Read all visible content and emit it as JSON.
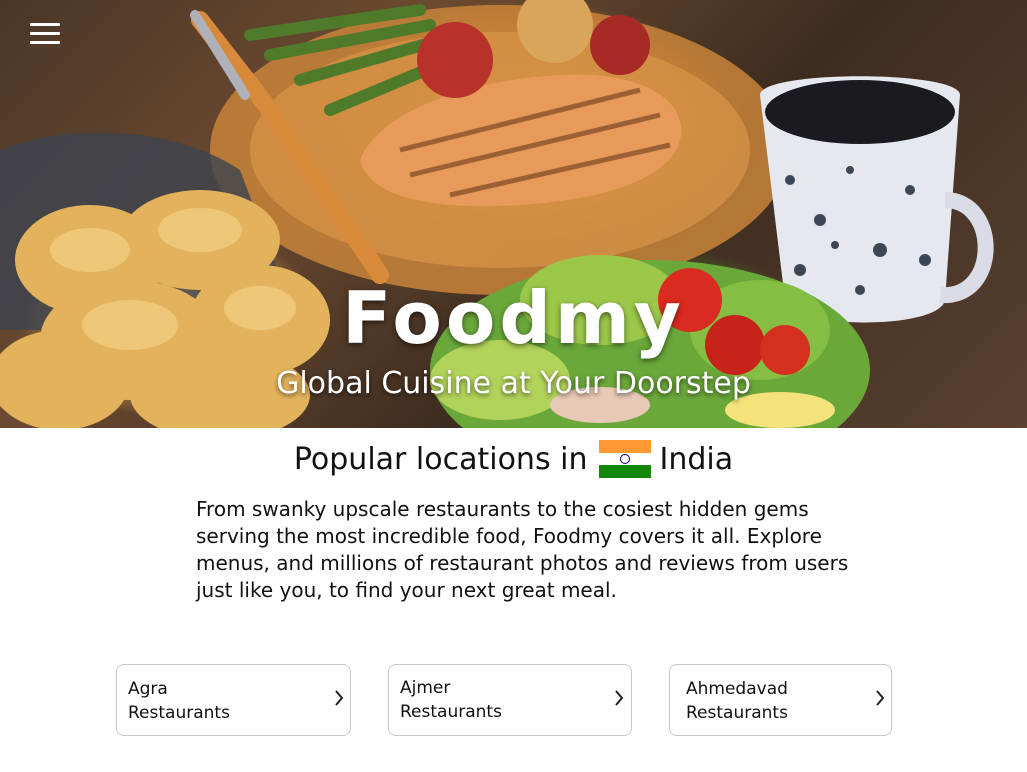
{
  "app": {
    "menu_icon": "hamburger-menu-icon",
    "title": "Foodmy",
    "subtitle": "Global Cuisine at Your Doorstep"
  },
  "section": {
    "heading_prefix": "Popular locations in",
    "country": "India",
    "flag_icon": "india-flag-icon",
    "description": "From swanky upscale restaurants to the cosiest hidden gems serving the most incredible food, Foodmy covers it all. Explore menus, and millions of restaurant photos and reviews from users just like you, to find your next great meal."
  },
  "locations": [
    {
      "label": "Agra\nRestaurants",
      "icon": "chevron-right-icon"
    },
    {
      "label": "Ajmer\nRestaurants",
      "icon": "chevron-right-icon"
    },
    {
      "label": "Ahmedavad\nRestaurants",
      "icon": "chevron-right-icon"
    }
  ],
  "colors": {
    "flag_saffron": "#ff9933",
    "flag_white": "#ffffff",
    "flag_green": "#138808",
    "flag_chakra": "#000080",
    "card_border": "#c8c8c8",
    "text": "#111111"
  }
}
